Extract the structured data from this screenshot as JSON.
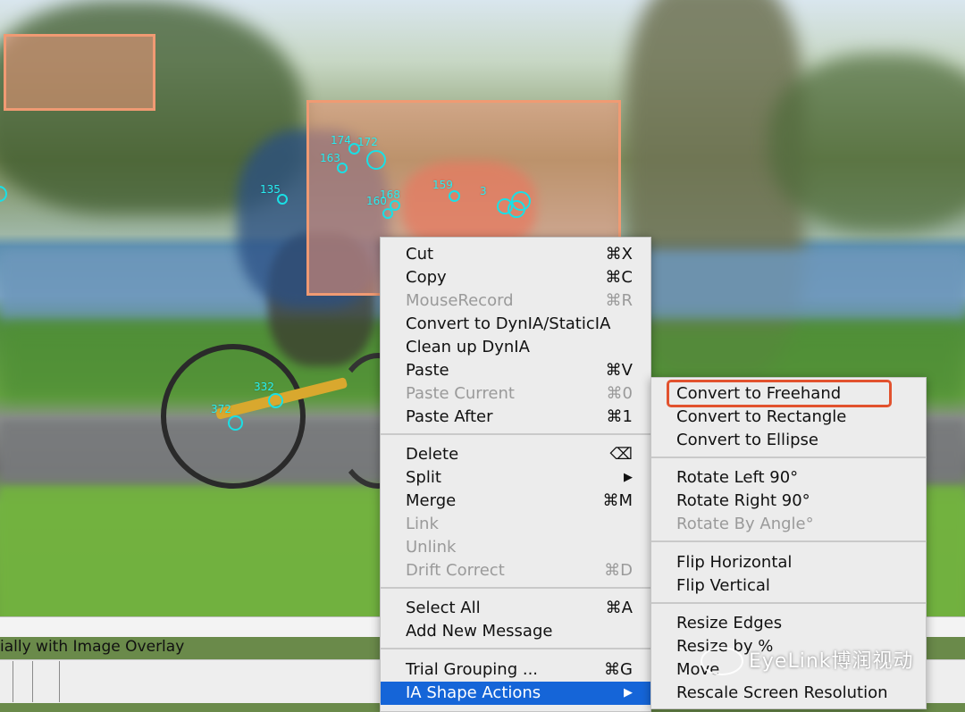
{
  "scene": {
    "interest_areas": 2,
    "fixations": [
      {
        "label": "174"
      },
      {
        "label": "172"
      },
      {
        "label": "163"
      },
      {
        "label": "135"
      },
      {
        "label": "160"
      },
      {
        "label": "168"
      },
      {
        "label": "159"
      },
      {
        "label": "3"
      },
      {
        "label": "332"
      },
      {
        "label": "372"
      }
    ]
  },
  "status": {
    "text": "ially with Image Overlay"
  },
  "context_menu": {
    "items": [
      {
        "label": "Cut",
        "shortcut": "⌘X",
        "disabled": false
      },
      {
        "label": "Copy",
        "shortcut": "⌘C",
        "disabled": false
      },
      {
        "label": "MouseRecord",
        "shortcut": "⌘R",
        "disabled": true
      },
      {
        "label": "Convert to DynIA/StaticIA",
        "shortcut": "",
        "disabled": false
      },
      {
        "label": "Clean up DynIA",
        "shortcut": "",
        "disabled": false
      },
      {
        "label": "Paste",
        "shortcut": "⌘V",
        "disabled": false
      },
      {
        "label": "Paste Current",
        "shortcut": "⌘0",
        "disabled": true
      },
      {
        "label": "Paste After",
        "shortcut": "⌘1",
        "disabled": false
      },
      {
        "label": "Delete",
        "shortcut": "⌫",
        "disabled": false
      },
      {
        "label": "Split",
        "shortcut": "▶",
        "disabled": false
      },
      {
        "label": "Merge",
        "shortcut": "⌘M",
        "disabled": false
      },
      {
        "label": "Link",
        "shortcut": "",
        "disabled": true
      },
      {
        "label": "Unlink",
        "shortcut": "",
        "disabled": true
      },
      {
        "label": "Drift Correct",
        "shortcut": "⌘D",
        "disabled": true
      },
      {
        "label": "Select All",
        "shortcut": "⌘A",
        "disabled": false
      },
      {
        "label": "Add New Message",
        "shortcut": "",
        "disabled": false
      },
      {
        "label": "Trial Grouping ...",
        "shortcut": "⌘G",
        "disabled": false
      },
      {
        "label": "IA Shape Actions",
        "shortcut": "▶",
        "disabled": false
      }
    ]
  },
  "submenu": {
    "items": [
      {
        "label": "Convert to Freehand",
        "disabled": false
      },
      {
        "label": "Convert to Rectangle",
        "disabled": false
      },
      {
        "label": "Convert to Ellipse",
        "disabled": false
      },
      {
        "label": "Rotate Left 90°",
        "disabled": false
      },
      {
        "label": "Rotate Right 90°",
        "disabled": false
      },
      {
        "label": "Rotate By Angle°",
        "disabled": true
      },
      {
        "label": "Flip Horizontal",
        "disabled": false
      },
      {
        "label": "Flip Vertical",
        "disabled": false
      },
      {
        "label": "Resize Edges",
        "disabled": false
      },
      {
        "label": "Resize by %",
        "disabled": false
      },
      {
        "label": "Move",
        "disabled": false
      },
      {
        "label": "Rescale Screen Resolution",
        "disabled": false
      }
    ]
  },
  "watermark": {
    "text": "EyeLink博润视动"
  },
  "colors": {
    "accent": "#1565d8",
    "highlight": "#e2522e",
    "ia_border": "#f09a73",
    "fixation": "#19e0e6"
  }
}
